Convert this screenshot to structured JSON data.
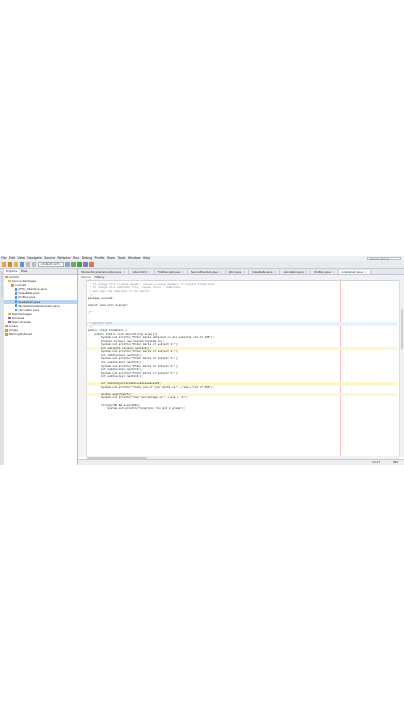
{
  "menubar": {
    "items": [
      "File",
      "Edit",
      "View",
      "Navigate",
      "Source",
      "Refactor",
      "Run",
      "Debug",
      "Profile",
      "Team",
      "Tools",
      "Window",
      "Help"
    ],
    "search_placeholder": "Search (Ctrl+I)"
  },
  "toolbar": {
    "config_combo": "<default confi..."
  },
  "projects": {
    "tabs": [
      "Projects",
      "Files"
    ],
    "tree": [
      {
        "label": "CoolUS",
        "indent": 0,
        "icon": "project-icon",
        "selected": false
      },
      {
        "label": "Source Packages",
        "indent": 1,
        "icon": "source-folder-icon",
        "selected": false
      },
      {
        "label": "coolus0",
        "indent": 2,
        "icon": "package-icon",
        "selected": false
      },
      {
        "label": "ATTC_Interface.java",
        "indent": 3,
        "icon": "java-file-icon",
        "selected": false
      },
      {
        "label": "ClassRate.java",
        "indent": 3,
        "icon": "java-file-icon",
        "selected": false
      },
      {
        "label": "DivBox.java",
        "indent": 3,
        "icon": "java-file-icon",
        "selected": false
      },
      {
        "label": "GradeCalc.java",
        "indent": 3,
        "icon": "java-file-icon",
        "selected": true
      },
      {
        "label": "StudentGradeCalculator.java",
        "indent": 3,
        "icon": "java-file-icon",
        "selected": false
      },
      {
        "label": "calculator.java",
        "indent": 3,
        "icon": "java-file-icon",
        "selected": false
      },
      {
        "label": "Test Packages",
        "indent": 1,
        "icon": "source-folder-icon",
        "selected": false
      },
      {
        "label": "Libraries",
        "indent": 1,
        "icon": "library-icon",
        "selected": false
      },
      {
        "label": "Test Libraries",
        "indent": 1,
        "icon": "library-icon",
        "selected": false
      },
      {
        "label": "coolus",
        "indent": 0,
        "icon": "project-icon",
        "selected": false
      },
      {
        "label": "simple",
        "indent": 0,
        "icon": "project-icon",
        "selected": false
      },
      {
        "label": "NamingOutlined",
        "indent": 0,
        "icon": "project-icon",
        "selected": false
      }
    ]
  },
  "editor": {
    "tabs": [
      {
        "label": "StudentGradeCalculator.java",
        "active": false
      },
      {
        "label": "index.html",
        "active": false
      },
      {
        "label": "FirstServlet.java",
        "active": false
      },
      {
        "label": "SecondServlet.java",
        "active": false
      },
      {
        "label": "Jdbc.java",
        "active": false
      },
      {
        "label": "ClassRate.java",
        "active": false
      },
      {
        "label": "calculator.java",
        "active": false
      },
      {
        "label": "DivBox.java",
        "active": false
      },
      {
        "label": "GradeCalc.java",
        "active": true
      }
    ],
    "view_tabs": [
      "Source",
      "History"
    ],
    "lines": [
      {
        "n": "1",
        "text": "/*",
        "type": "comment"
      },
      {
        "n": "2",
        "text": " * To change this license header, choose License Headers in Project Properties.",
        "type": "comment"
      },
      {
        "n": "3",
        "text": " * To change this template file, choose Tools | Templates",
        "type": "comment"
      },
      {
        "n": "4",
        "text": " * and open the template in the editor.",
        "type": "comment"
      },
      {
        "n": "5",
        "text": " */",
        "type": "comment"
      },
      {
        "n": "6",
        "text": "package coolus0;",
        "type": "code"
      },
      {
        "n": "7",
        "text": "",
        "type": "code"
      },
      {
        "n": "8",
        "text": "import java.util.Scanner;",
        "type": "code"
      },
      {
        "n": "9",
        "text": "",
        "type": "code"
      },
      {
        "n": "10",
        "text": "/**",
        "type": "comment"
      },
      {
        "n": "11",
        "text": "",
        "type": "code"
      },
      {
        "n": "12",
        "text": "",
        "type": "code"
      },
      {
        "n": "13",
        "text": " * @author Cool",
        "type": "caret"
      },
      {
        "n": "14",
        "text": " */",
        "type": "comment"
      },
      {
        "n": "15",
        "text": "public class GradeCalc {",
        "type": "code"
      },
      {
        "n": "16",
        "text": "    public static void main(String args[]){",
        "type": "code"
      },
      {
        "n": "17",
        "text": "        System.out.println(\"Enter marks obtained in all subjects out of 100\");",
        "type": "code"
      },
      {
        "n": "18",
        "text": "        Scanner scnner= new Scanner(System.in);",
        "type": "code"
      },
      {
        "n": "19",
        "text": "        System.out.println(\"Enter marks of subject 1:\");",
        "type": "code"
      },
      {
        "n": "20",
        "text": "        int subject1 =scnner.nextInt();",
        "type": "hilite"
      },
      {
        "n": "21",
        "text": "        System.out.println(\"Enter marks of subject 2:\");",
        "type": "code"
      },
      {
        "n": "22",
        "text": "        int sub2=scnner.nextInt();",
        "type": "code"
      },
      {
        "n": "23",
        "text": "        System.out.println(\"Enter marks of subject 3:\");",
        "type": "code"
      },
      {
        "n": "24",
        "text": "        int sub3=scnner.nextInt();",
        "type": "code"
      },
      {
        "n": "25",
        "text": "        System.out.println(\"Enter marks of subject 4:\");",
        "type": "code"
      },
      {
        "n": "26",
        "text": "        int sub4=scnner.nextInt();",
        "type": "code"
      },
      {
        "n": "27",
        "text": "        System.out.println(\"Enter marks of subject 5:\");",
        "type": "code"
      },
      {
        "n": "28",
        "text": "        int sub5=scnner.nextInt();",
        "type": "code"
      },
      {
        "n": "29",
        "text": "",
        "type": "code"
      },
      {
        "n": "30",
        "text": "        int Sum=subject1+sub2+sub3+sub4+sub5;",
        "type": "hilite"
      },
      {
        "n": "31",
        "text": "        System.out.println(\"Total sum of your marks is:\" + Sum +\"out of 500\");",
        "type": "code"
      },
      {
        "n": "32",
        "text": "",
        "type": "code"
      },
      {
        "n": "33",
        "text": "        double avg=(Sum/5);",
        "type": "hilite"
      },
      {
        "n": "34",
        "text": "        System.out.println(\"Your percentage is:\" + avg + \"%\");",
        "type": "code"
      },
      {
        "n": "35",
        "text": "",
        "type": "code"
      },
      {
        "n": "36",
        "text": "        if(avg>=90 && avg<=100){",
        "type": "code"
      },
      {
        "n": "37",
        "text": "            System.out.println(\"Congrats! You got A grade\");",
        "type": "code"
      }
    ]
  },
  "status": {
    "position": "13:17",
    "mode": "INS"
  },
  "colors": {
    "selection": "#bcd4f3",
    "margin_line": "#f1c0c0"
  }
}
